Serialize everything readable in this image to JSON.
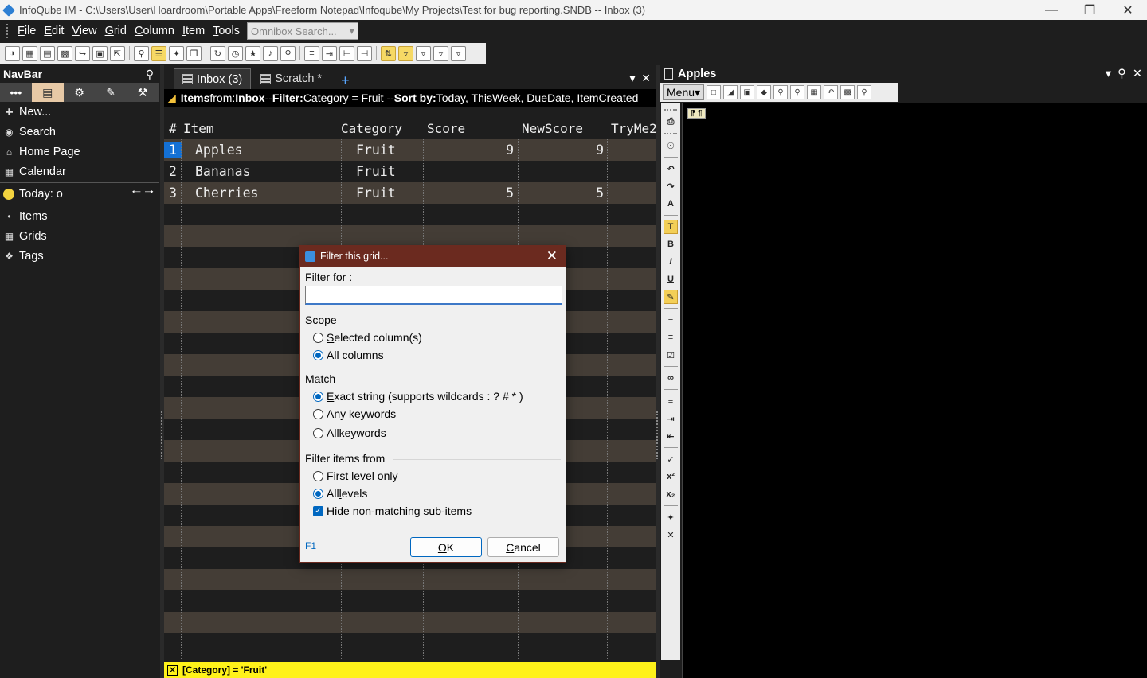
{
  "window": {
    "title": "InfoQube IM - C:\\Users\\User\\Hoardroom\\Portable Apps\\Freeform Notepad\\Infoqube\\My Projects\\Test for bug reporting.SNDB -- Inbox (3)"
  },
  "menubar": {
    "items": [
      {
        "u": "F",
        "rest": "ile"
      },
      {
        "u": "E",
        "rest": "dit"
      },
      {
        "u": "V",
        "rest": "iew"
      },
      {
        "u": "G",
        "rest": "rid"
      },
      {
        "u": "C",
        "rest": "olumn"
      },
      {
        "u": "I",
        "rest": "tem"
      },
      {
        "u": "T",
        "rest": "ools"
      }
    ],
    "omnibox_placeholder": "Omnibox Search..."
  },
  "navbar": {
    "title": "NavBar",
    "tab_more": "•••",
    "items": [
      {
        "label": "New...",
        "icon": "plus-icon"
      },
      {
        "label": "Search",
        "icon": "binoculars-icon"
      },
      {
        "label": "Home Page",
        "icon": "home-icon"
      },
      {
        "label": "Calendar",
        "icon": "calendar-icon"
      }
    ],
    "today": "Today: o",
    "lower_items": [
      {
        "label": "Items",
        "icon": "items-icon"
      },
      {
        "label": "Grids",
        "icon": "grid-icon"
      },
      {
        "label": "Tags",
        "icon": "tag-icon"
      }
    ]
  },
  "tabs": {
    "inbox": "Inbox (3)",
    "scratch": "Scratch *",
    "add": "+"
  },
  "filterbar": {
    "items_from_label": "Items",
    "from_word": " from: ",
    "source": "Inbox",
    "filter_sep": " -- ",
    "filter_label": "Filter:",
    "filter_value": " Category = Fruit -- ",
    "sort_label": "Sort by:",
    "sort_value": " Today, ThisWeek, DueDate, ItemCreated"
  },
  "grid": {
    "columns": {
      "num": "#",
      "item": "Item",
      "category": "Category",
      "score": "Score",
      "newscore": "NewScore",
      "tryme": "TryMe2"
    },
    "rows": [
      {
        "num": "1",
        "item": "Apples",
        "category": "Fruit",
        "score": "9",
        "newscore": "9"
      },
      {
        "num": "2",
        "item": "Bananas",
        "category": "Fruit",
        "score": "",
        "newscore": ""
      },
      {
        "num": "3",
        "item": "Cherries",
        "category": "Fruit",
        "score": "5",
        "newscore": "5"
      }
    ]
  },
  "statusbar": {
    "filter": "[Category] = 'Fruit'"
  },
  "notepane": {
    "title": "Apples",
    "menu": "Menu",
    "marks": "⁋ ¶"
  },
  "dialog": {
    "title": "Filter this grid...",
    "filter_for_u": "F",
    "filter_for_rest": "ilter for :",
    "filter_value": "",
    "scope": "Scope",
    "scope_opts": [
      {
        "u": "S",
        "rest": "elected column(s)",
        "on": false
      },
      {
        "u": "A",
        "rest": "ll columns",
        "on": true
      }
    ],
    "match": "Match",
    "match_opts": [
      {
        "u": "E",
        "rest": "xact string (supports wildcards : ? # * )",
        "on": true
      },
      {
        "u": "A",
        "rest": "ny keywords",
        "on": false
      },
      {
        "pre": "All ",
        "u": "k",
        "rest": "eywords",
        "on": false
      }
    ],
    "from": "Filter items from",
    "from_opts": [
      {
        "u": "F",
        "rest": "irst level only",
        "on": false
      },
      {
        "pre": "All ",
        "u": "l",
        "rest": "evels",
        "on": true
      }
    ],
    "hide_u": "H",
    "hide_rest": "ide non-matching sub-items",
    "help": "F1",
    "ok_u": "O",
    "ok_rest": "K",
    "cancel_u": "C",
    "cancel_rest": "ancel"
  }
}
